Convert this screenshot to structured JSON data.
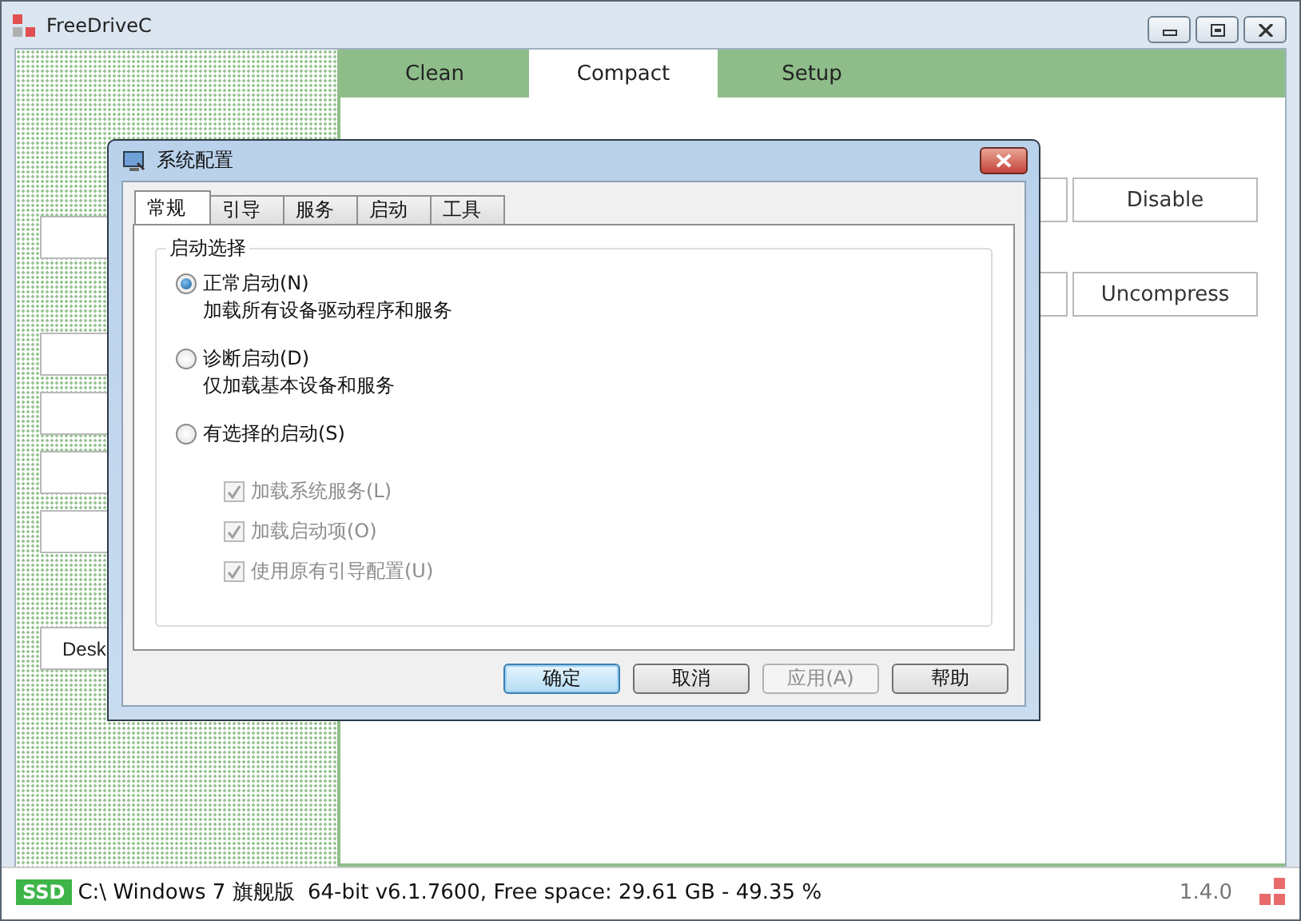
{
  "window": {
    "title": "FreeDriveC"
  },
  "main_tabs": [
    {
      "label": "Clean",
      "selected": false
    },
    {
      "label": "Compact",
      "selected": true
    },
    {
      "label": "Setup",
      "selected": false
    }
  ],
  "left_buttons": [
    {
      "kind": "blank"
    },
    {
      "kind": "blank"
    },
    {
      "kind": "blank"
    },
    {
      "kind": "blank"
    },
    {
      "kind": "blank"
    },
    {
      "kind": "text",
      "label": "Desk"
    }
  ],
  "compact_buttons": [
    {
      "label": "Disable"
    },
    {
      "label": "Uncompress"
    }
  ],
  "dialog": {
    "title": "系统配置",
    "tabs": [
      {
        "label": "常规",
        "selected": true
      },
      {
        "label": "引导",
        "selected": false
      },
      {
        "label": "服务",
        "selected": false
      },
      {
        "label": "启动",
        "selected": false
      },
      {
        "label": "工具",
        "selected": false
      }
    ],
    "group": "启动选择",
    "options": [
      {
        "label": "正常启动(N)",
        "description": "加载所有设备驱动程序和服务",
        "selected": true
      },
      {
        "label": "诊断启动(D)",
        "description": "仅加载基本设备和服务",
        "selected": false
      },
      {
        "label": "有选择的启动(S)",
        "selected": false
      }
    ],
    "checks": [
      {
        "label": "加载系统服务(L)",
        "checked": true,
        "disabled": true
      },
      {
        "label": "加载启动项(O)",
        "checked": true,
        "disabled": true
      },
      {
        "label": "使用原有引导配置(U)",
        "checked": true,
        "disabled": true
      }
    ],
    "buttons": [
      {
        "label": "确定",
        "kind": "default",
        "disabled": false
      },
      {
        "label": "取消",
        "kind": "normal",
        "disabled": false
      },
      {
        "label": "应用(A)",
        "kind": "normal",
        "disabled": true
      },
      {
        "label": "帮助",
        "kind": "normal",
        "disabled": false
      }
    ]
  },
  "status_bar": {
    "badge": "SSD",
    "text": "C:\\ Windows 7 旗舰版  64-bit v6.1.7600, Free space: 29.61 GB - 49.35 %",
    "version": "1.4.0"
  }
}
